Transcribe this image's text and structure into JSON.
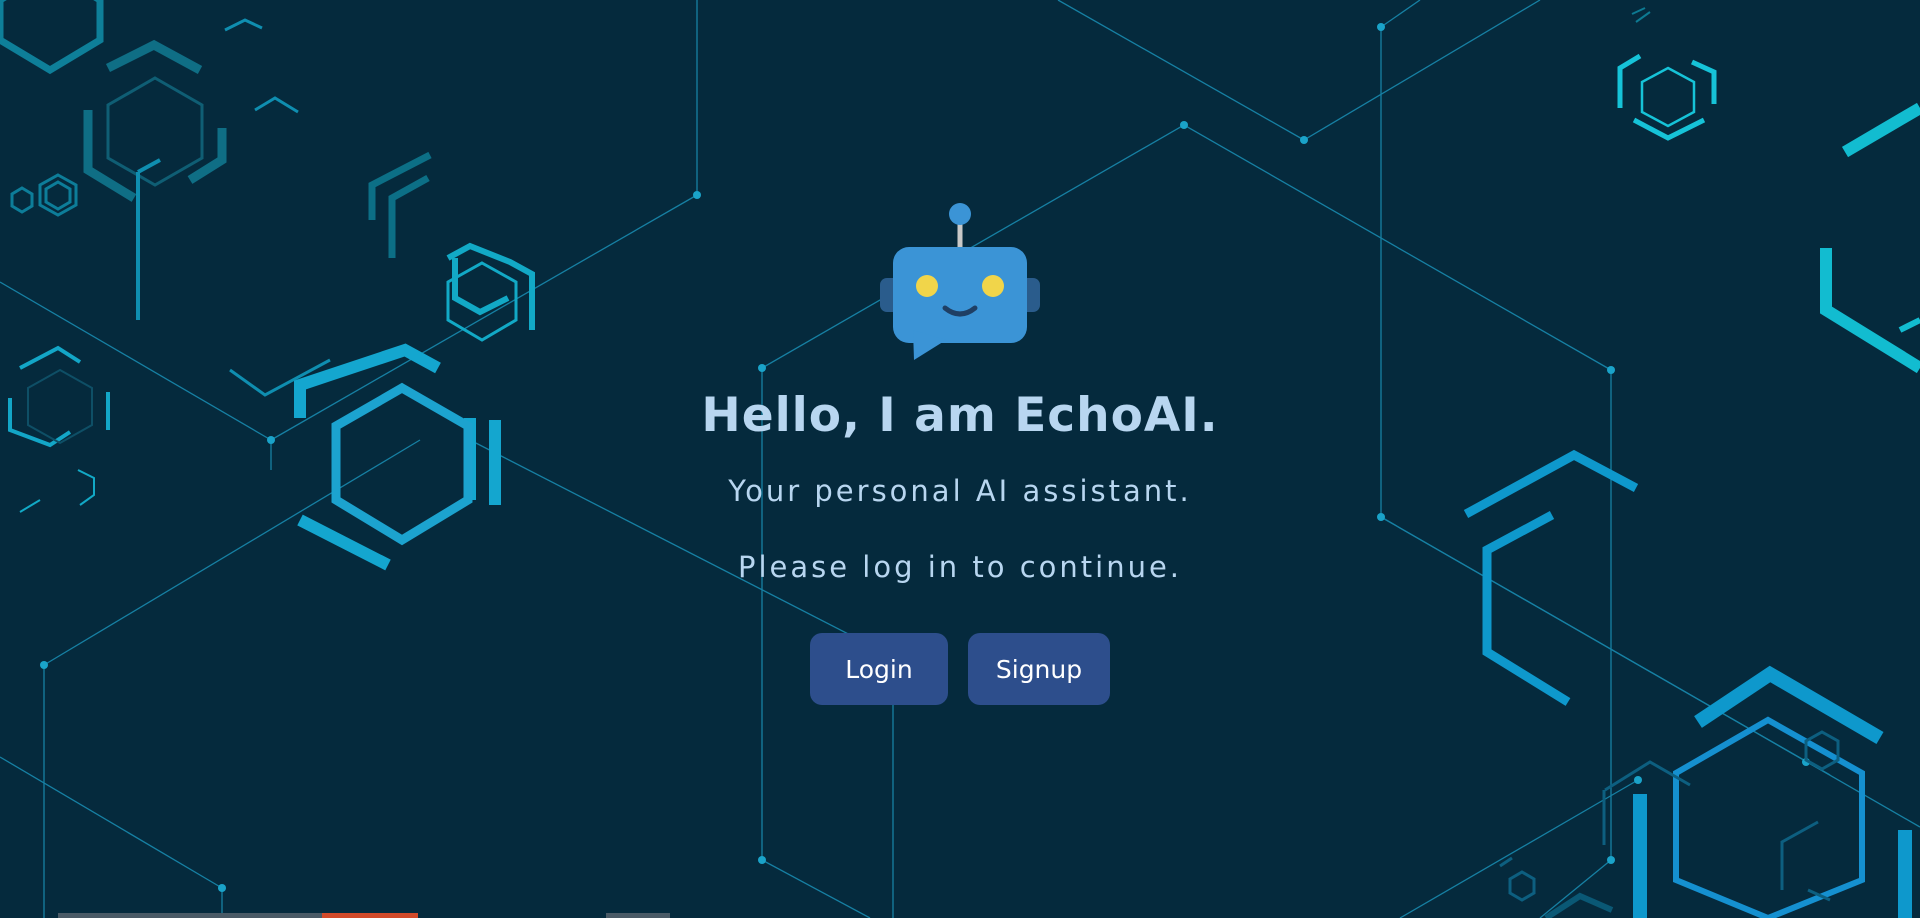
{
  "hero": {
    "title": "Hello, I am EchoAI.",
    "subtitle": "Your personal AI assistant.",
    "prompt": "Please log in to continue."
  },
  "actions": {
    "login_label": "Login",
    "signup_label": "Signup"
  },
  "logo": {
    "icon": "robot-chat-icon",
    "colors": {
      "head": "#3b94d6",
      "eyes": "#f1d54a",
      "antenna": "#3b94d6"
    }
  },
  "theme": {
    "background": "#052a3d",
    "accent": "#0fb6d4",
    "button": "#2d4e8c",
    "text": "#b8d6f0"
  }
}
